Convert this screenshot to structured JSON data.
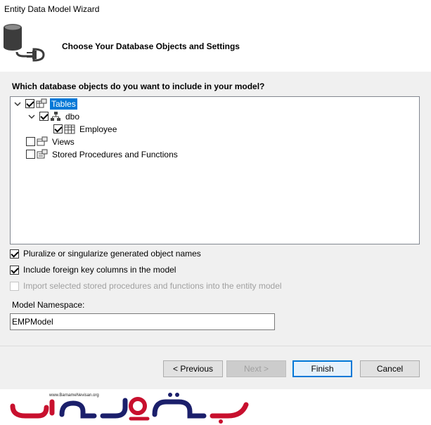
{
  "window": {
    "title": "Entity Data Model Wizard"
  },
  "header": {
    "heading": "Choose Your Database Objects and Settings",
    "icon": "database-connection-icon"
  },
  "tree": {
    "question": "Which database objects do you want to include in your model?",
    "nodes": {
      "tables": {
        "label": "Tables",
        "checked": true,
        "expanded": true,
        "selected": true
      },
      "dbo": {
        "label": "dbo",
        "checked": true,
        "expanded": true
      },
      "employee": {
        "label": "Employee",
        "checked": true
      },
      "views": {
        "label": "Views",
        "checked": false
      },
      "stored_procs": {
        "label": "Stored Procedures and Functions",
        "checked": false
      }
    }
  },
  "options": {
    "pluralize": {
      "label": "Pluralize or singularize generated object names",
      "checked": true
    },
    "foreign_keys": {
      "label": "Include foreign key columns in the model",
      "checked": true
    },
    "import_procs": {
      "label": "Import selected stored procedures and functions into the entity model",
      "checked": false,
      "enabled": false
    }
  },
  "namespace": {
    "label": "Model Namespace:",
    "value": "EMPModel"
  },
  "buttons": {
    "previous": "< Previous",
    "next": "Next >",
    "finish": "Finish",
    "cancel": "Cancel"
  },
  "watermark": {
    "url": "www.BarnameNevisan.org",
    "logo_text": "برنامه نویسان"
  }
}
